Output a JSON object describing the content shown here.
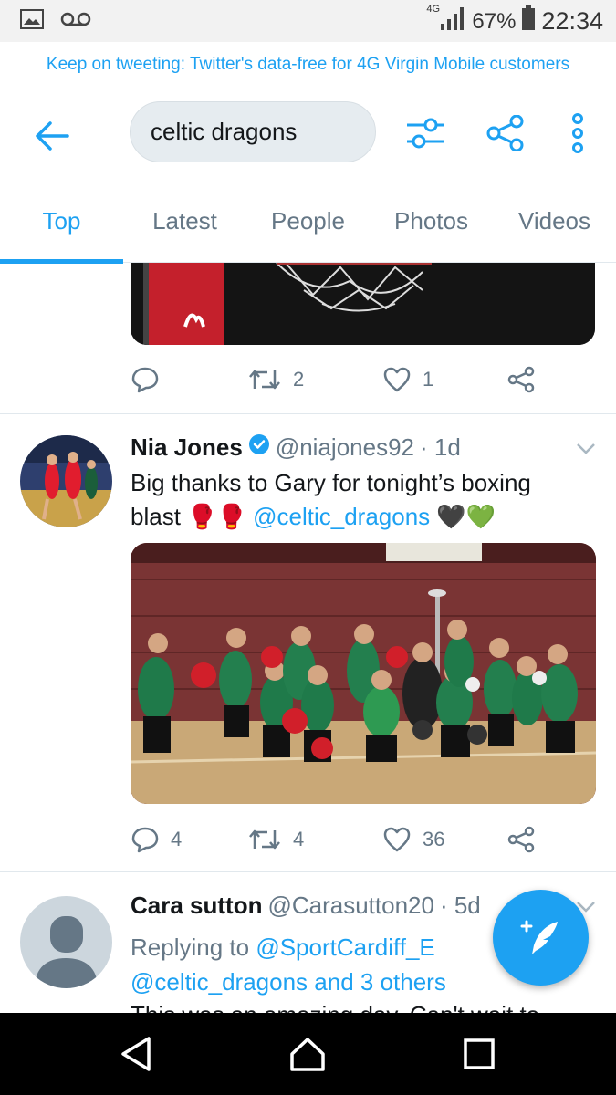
{
  "status_bar": {
    "network": "4G",
    "battery": "67%",
    "time": "22:34",
    "icons": [
      "image-icon",
      "voicemail-icon",
      "signal-icon",
      "battery-icon"
    ]
  },
  "promo": {
    "text": "Keep on tweeting: Twitter's data-free for 4G Virgin Mobile customers"
  },
  "header": {
    "search_value": "celtic dragons",
    "icons": [
      "back-arrow-icon",
      "filter-icon",
      "share-icon",
      "more-vertical-icon"
    ]
  },
  "tabs": [
    {
      "label": "Top",
      "active": true
    },
    {
      "label": "Latest",
      "active": false
    },
    {
      "label": "People",
      "active": false
    },
    {
      "label": "Photos",
      "active": false
    },
    {
      "label": "Videos",
      "active": false
    }
  ],
  "tweets": [
    {
      "replies": "",
      "retweets": "2",
      "likes": "1"
    },
    {
      "name": "Nia Jones",
      "handle": "@niajones92",
      "time": "· 1d",
      "verified": true,
      "text_before": "Big thanks to Gary for tonight’s boxing blast 🥊🥊 ",
      "mention": "@celtic_dragons",
      "text_after": " 🖤💚",
      "replies": "4",
      "retweets": "4",
      "likes": "36"
    },
    {
      "name": "Cara sutton",
      "handle": "@Carasutton20",
      "time": "· 5d",
      "reply_prefix": "Replying to ",
      "reply_to": "@SportCardiff_E",
      "reply_line2": "@celtic_dragons and 3 others",
      "text_cut": "This was an amazing day. Can't wait to"
    }
  ],
  "colors": {
    "accent": "#1da1f2",
    "muted": "#657786",
    "text": "#14171a"
  }
}
